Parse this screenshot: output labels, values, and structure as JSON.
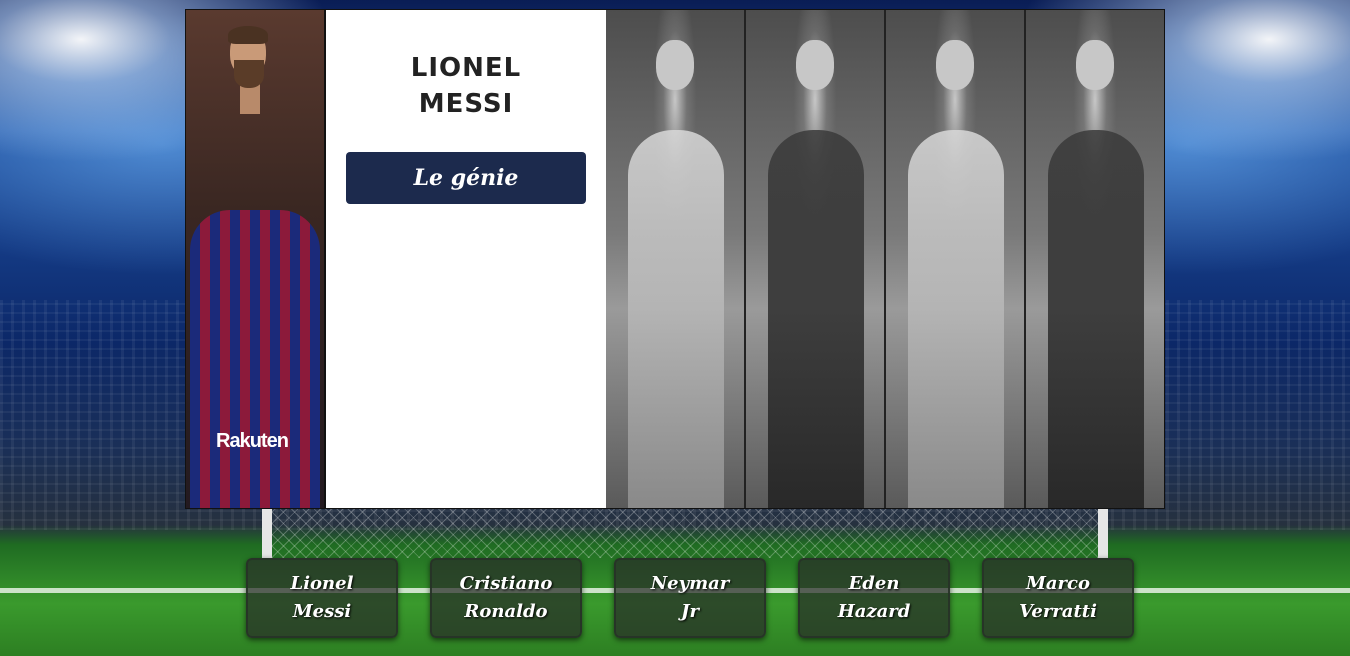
{
  "featured": {
    "first_name": "LIONEL",
    "last_name": "MESSI",
    "tagline": "Le génie",
    "photo_sponsor": "Rakuten"
  },
  "gallery": {
    "players": [
      "Cristiano Ronaldo",
      "Neymar Jr",
      "Eden Hazard",
      "Marco Verratti"
    ]
  },
  "player_buttons": [
    {
      "line1": "Lionel",
      "line2": "Messi"
    },
    {
      "line1": "Cristiano",
      "line2": "Ronaldo"
    },
    {
      "line1": "Neymar",
      "line2": "Jr"
    },
    {
      "line1": "Eden",
      "line2": "Hazard"
    },
    {
      "line1": "Marco",
      "line2": "Verratti"
    }
  ],
  "colors": {
    "tagline_bg": "#1c2a4d",
    "button_bg": "#2d2d28"
  }
}
